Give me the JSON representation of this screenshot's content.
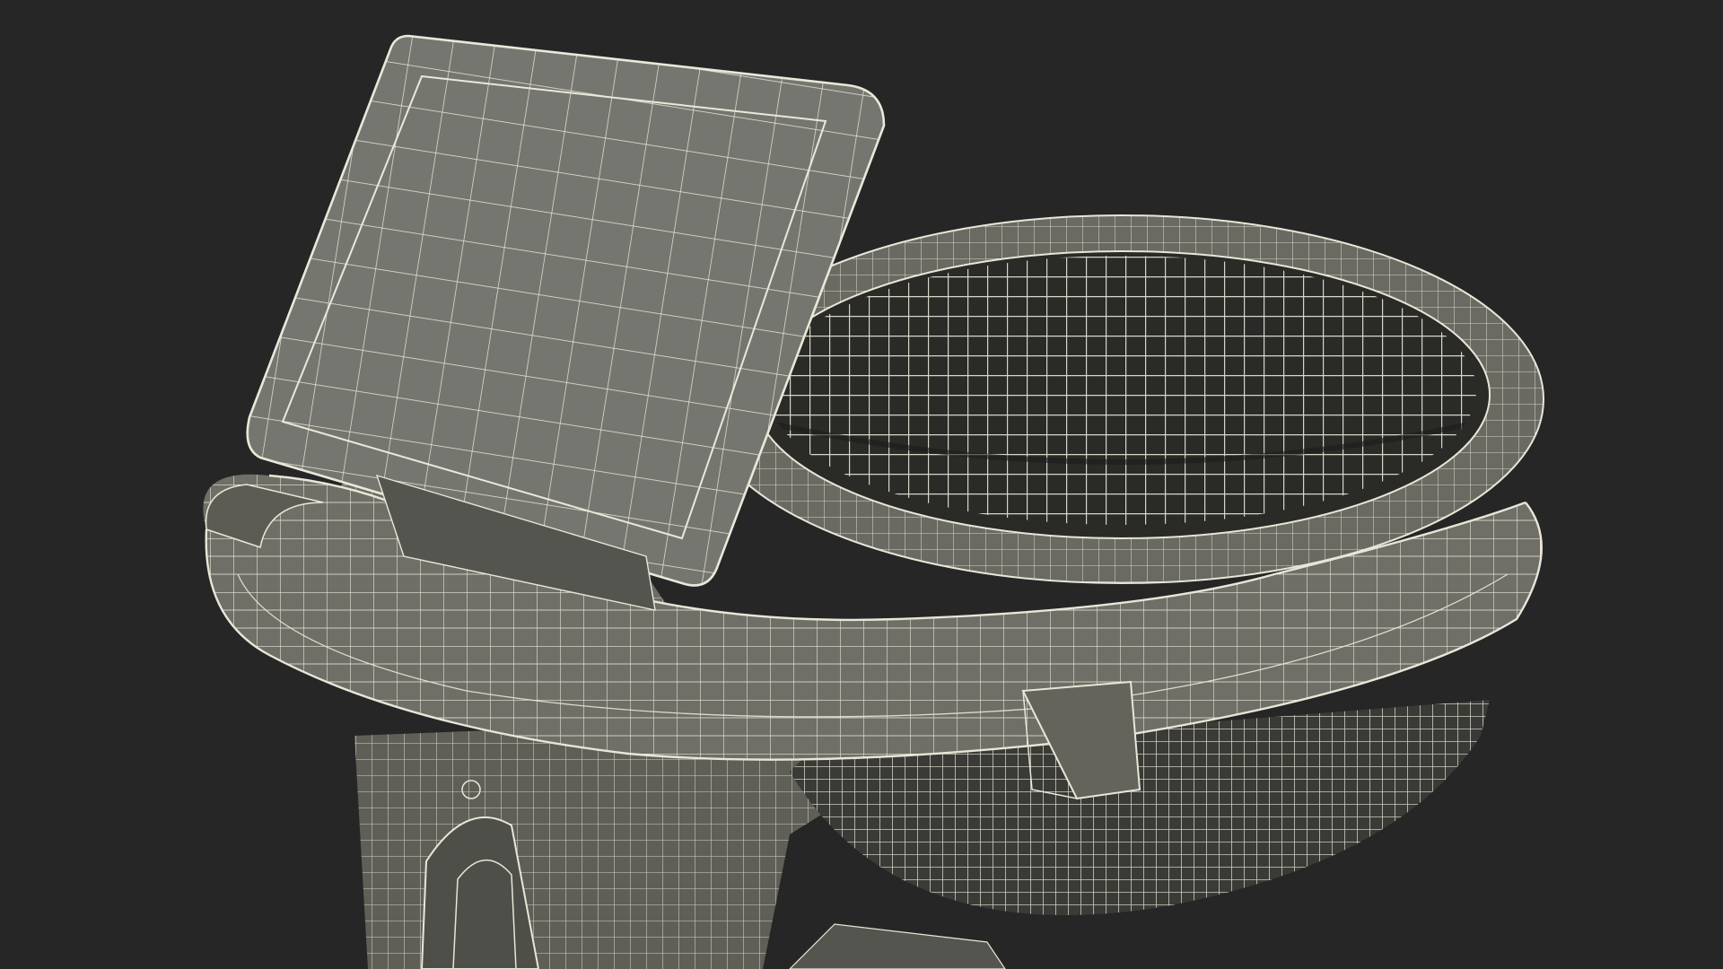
{
  "scene": {
    "background_color": "#262626",
    "model_color": "#6f6f66",
    "wire_color": "#e9e6d8",
    "object": "wireframe-render"
  }
}
